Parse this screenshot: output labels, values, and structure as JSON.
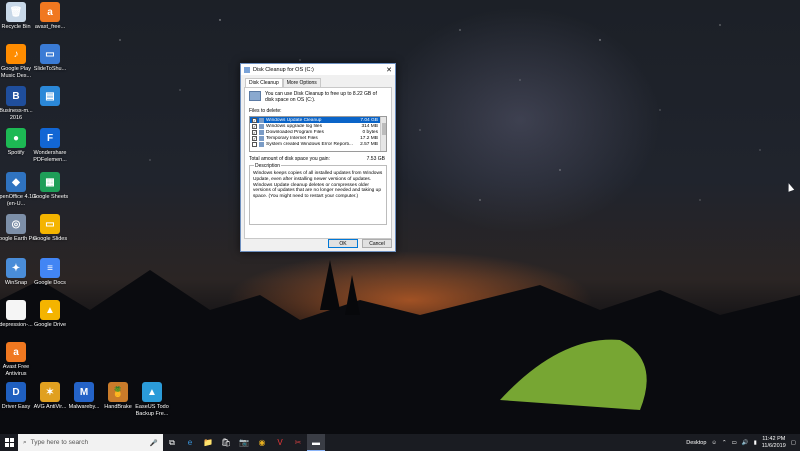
{
  "desktop_icons": [
    {
      "name": "recycle-bin",
      "label": "Recycle Bin",
      "glyph": "🗑",
      "color": "#c8d8e8"
    },
    {
      "name": "avast-free",
      "label": "avast_free...",
      "glyph": "a",
      "color": "#f07820"
    },
    {
      "name": "google-play-music",
      "label": "Google Play Music Des...",
      "glyph": "♪",
      "color": "#ff8c00"
    },
    {
      "name": "slidetoshutdown",
      "label": "SlideToShu...",
      "glyph": "▭",
      "color": "#3a7bd5"
    },
    {
      "name": "business-2016",
      "label": "Business-m... 2016",
      "glyph": "B",
      "color": "#1f4e9c"
    },
    {
      "name": "shortcut-blue",
      "label": "",
      "glyph": "▤",
      "color": "#2b88d8"
    },
    {
      "name": "spotify",
      "label": "Spotify",
      "glyph": "●",
      "color": "#1db954"
    },
    {
      "name": "wondershare-pdfelement",
      "label": "Wondershare PDFelemen...",
      "glyph": "F",
      "color": "#1266d4"
    },
    {
      "name": "openoffice",
      "label": "OpenOffice 4.1.6 (en-U...",
      "glyph": "◆",
      "color": "#2f73c0"
    },
    {
      "name": "google-sheets",
      "label": "Google Sheets",
      "glyph": "▦",
      "color": "#1e9e58"
    },
    {
      "name": "google-earth-pro",
      "label": "Google Earth Pro",
      "glyph": "◎",
      "color": "#7d8fa8"
    },
    {
      "name": "google-slides",
      "label": "Google Slides",
      "glyph": "▭",
      "color": "#f4b400"
    },
    {
      "name": "winsnap",
      "label": "WinSnap",
      "glyph": "✦",
      "color": "#4a8dd8"
    },
    {
      "name": "google-docs",
      "label": "Google Docs",
      "glyph": "≡",
      "color": "#4285f4"
    },
    {
      "name": "depression-file",
      "label": "depression-...",
      "glyph": "",
      "color": "#f5f5f5"
    },
    {
      "name": "google-drive",
      "label": "Google Drive",
      "glyph": "▲",
      "color": "#f4b400"
    },
    {
      "name": "avast-free-antivirus",
      "label": "Avast Free Antivirus",
      "glyph": "a",
      "color": "#f07820"
    },
    {
      "name": "driver-easy",
      "label": "Driver Easy",
      "glyph": "D",
      "color": "#1f5fbf"
    },
    {
      "name": "avg-antivirus",
      "label": "AVG AntiVir...",
      "glyph": "✶",
      "color": "#e0a020"
    },
    {
      "name": "malwarebytes",
      "label": "Malwareby...",
      "glyph": "M",
      "color": "#2463c7"
    },
    {
      "name": "handbrake",
      "label": "HandBrake",
      "glyph": "🍍",
      "color": "#c97b2a"
    },
    {
      "name": "easeus-todo-backup",
      "label": "EaseUS Todo Backup Fre...",
      "glyph": "▲",
      "color": "#2b9bd8"
    }
  ],
  "dialog": {
    "title": "Disk Cleanup for OS (C:)",
    "close_glyph": "✕",
    "tabs": [
      "Disk Cleanup",
      "More Options"
    ],
    "intro": "You can use Disk Cleanup to free up to 8.22 GB of disk space on OS (C:).",
    "files_label": "Files to delete:",
    "files": [
      {
        "checked": true,
        "name": "Windows Update Cleanup",
        "size": "7.04 GB",
        "selected": true
      },
      {
        "checked": true,
        "name": "Windows upgrade log files",
        "size": "314 MB",
        "selected": false
      },
      {
        "checked": true,
        "name": "Downloaded Program Files",
        "size": "0 bytes",
        "selected": false
      },
      {
        "checked": true,
        "name": "Temporary Internet Files",
        "size": "17.2 MB",
        "selected": false
      },
      {
        "checked": false,
        "name": "System created Windows Error Reporti...",
        "size": "2.57 MB",
        "selected": false
      }
    ],
    "total_label": "Total amount of disk space you gain:",
    "total_value": "7.53 GB",
    "description_title": "Description",
    "description_text": "Windows keeps copies of all installed updates from Windows Update, even after installing newer versions of updates. Windows Update cleanup deletes or compresses older versions of updates that are no longer needed and taking up space. (You might need to restart your computer.)",
    "ok_label": "OK",
    "cancel_label": "Cancel"
  },
  "taskbar": {
    "search_placeholder": "Type here to search",
    "apps": [
      {
        "name": "task-view",
        "glyph": "⧉"
      },
      {
        "name": "edge",
        "glyph": "e",
        "color": "#3a96dd"
      },
      {
        "name": "file-explorer",
        "glyph": "📁"
      },
      {
        "name": "store",
        "glyph": "🛍"
      },
      {
        "name": "camera-app",
        "glyph": "📷"
      },
      {
        "name": "chrome",
        "glyph": "◉",
        "color": "#e8b020"
      },
      {
        "name": "vivaldi",
        "glyph": "V",
        "color": "#ef3939"
      },
      {
        "name": "app-red",
        "glyph": "✂",
        "color": "#d04040"
      },
      {
        "name": "disk-cleanup",
        "glyph": "▬",
        "active": true
      }
    ],
    "tray_label": "Desktop",
    "time": "11:42 PM",
    "date": "11/6/2019"
  }
}
